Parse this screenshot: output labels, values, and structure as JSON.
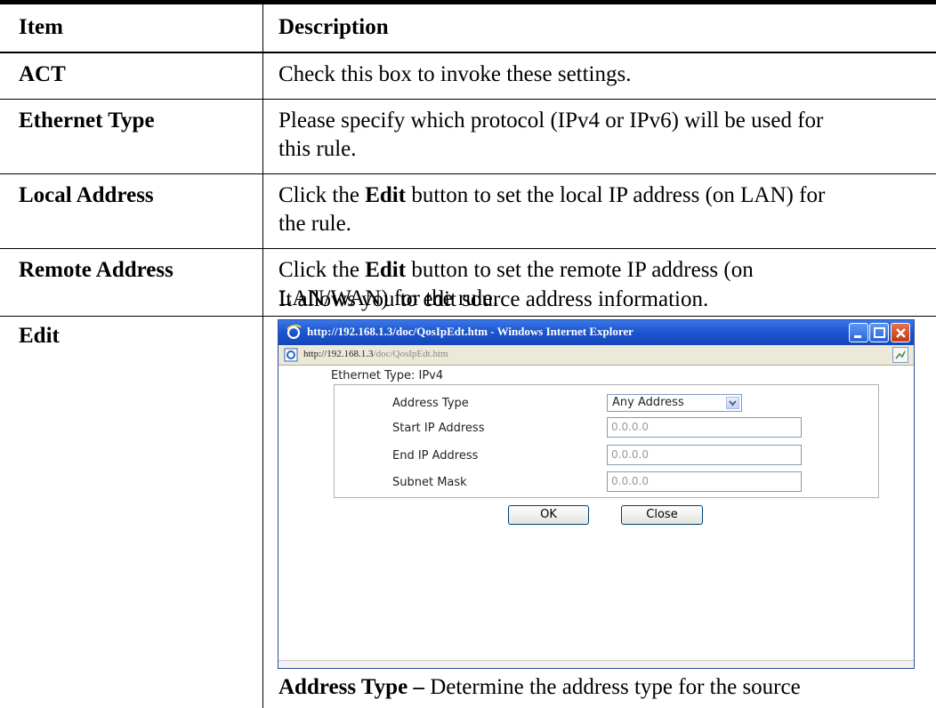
{
  "table": {
    "headers": {
      "item": "Item",
      "description": "Description"
    },
    "rows": [
      {
        "item": "ACT",
        "desc": "Check this box to invoke these settings."
      },
      {
        "item": "Ethernet Type",
        "desc1": "Please specify which protocol (IPv4 or IPv6) will be used for",
        "desc2": "this rule."
      },
      {
        "item": "Local Address",
        "pre": "Click the ",
        "bold": "Edit",
        "post": " button to set the local IP address (on LAN) for",
        "desc2": "the rule."
      },
      {
        "item": "Remote Address",
        "pre": "Click the ",
        "bold": "Edit",
        "post": " button to set the remote IP address (on",
        "desc2": "LAN/WAN) for the rule."
      },
      {
        "item": "Edit",
        "desc": "It allows you to edit source address information."
      }
    ],
    "footer": {
      "bold": "Address Type –",
      "rest": " Determine the address type for the source"
    }
  },
  "window": {
    "title": "http://192.168.1.3/doc/QosIpEdt.htm - Windows Internet Explorer",
    "address_host": "http://192.168.1.3",
    "address_path": "/doc/QosIpEdt.htm",
    "icons": [
      "ie-logo-icon",
      "minimize-icon",
      "maximize-icon",
      "close-icon",
      "page-icon"
    ]
  },
  "dialog": {
    "ethernet_type_label": "Ethernet Type: IPv4",
    "fields": {
      "address_type_label": "Address Type",
      "address_type_value": "Any Address",
      "start_ip_label": "Start IP Address",
      "start_ip_value": "0.0.0.0",
      "end_ip_label": "End IP Address",
      "end_ip_value": "0.0.0.0",
      "subnet_mask_label": "Subnet Mask",
      "subnet_mask_value": "0.0.0.0"
    },
    "buttons": {
      "ok": "OK",
      "close": "Close"
    }
  },
  "colors": {
    "titlebar": "#1d56d1",
    "close_button": "#c03a13",
    "field_border": "#7f9db9"
  }
}
